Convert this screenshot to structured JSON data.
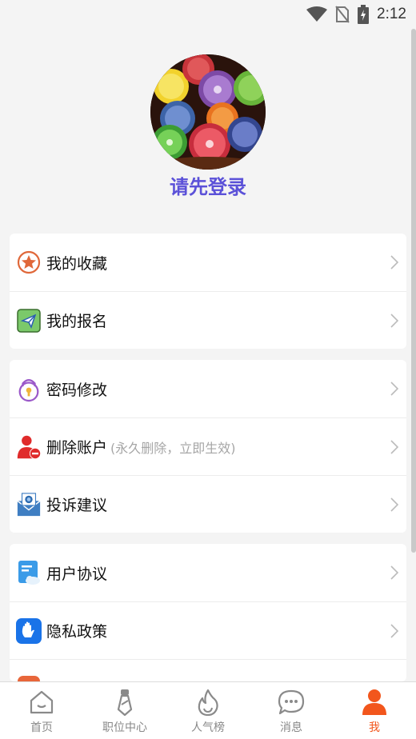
{
  "status_bar": {
    "time": "2:12",
    "icons": [
      "wifi-icon",
      "no-sim-icon",
      "battery-charging-icon"
    ]
  },
  "profile": {
    "avatar": "fruit-slices-avatar",
    "login_text": "请先登录"
  },
  "menu_groups": [
    {
      "items": [
        {
          "icon": "star-badge-icon",
          "label": "我的收藏"
        },
        {
          "icon": "paper-plane-icon",
          "label": "我的报名"
        }
      ]
    },
    {
      "items": [
        {
          "icon": "lock-icon",
          "label": "密码修改"
        },
        {
          "icon": "delete-user-icon",
          "label": "删除账户",
          "hint": "(永久删除，立即生效)"
        },
        {
          "icon": "mail-envelope-icon",
          "label": "投诉建议"
        }
      ]
    },
    {
      "items": [
        {
          "icon": "document-icon",
          "label": "用户协议"
        },
        {
          "icon": "hand-shield-icon",
          "label": "隐私政策"
        }
      ]
    }
  ],
  "tabbar": {
    "tabs": [
      {
        "icon": "home-icon",
        "label": "首页",
        "active": false
      },
      {
        "icon": "tie-icon",
        "label": "职位中心",
        "active": false
      },
      {
        "icon": "flame-icon",
        "label": "人气榜",
        "active": false
      },
      {
        "icon": "chat-bubble-icon",
        "label": "消息",
        "active": false
      },
      {
        "icon": "user-icon",
        "label": "我",
        "active": true
      }
    ]
  },
  "colors": {
    "accent": "#f2561c",
    "login_text": "#5b51d8",
    "background": "#f4f4f4"
  }
}
